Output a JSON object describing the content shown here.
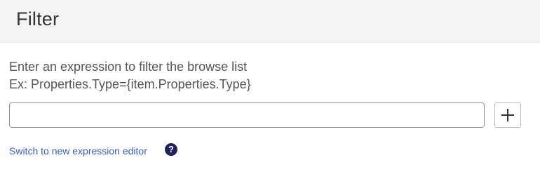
{
  "header": {
    "title": "Filter"
  },
  "description": {
    "line1": "Enter an expression to filter the browse list",
    "line2": "Ex: Properties.Type={item.Properties.Type}"
  },
  "filter_input": {
    "value": "",
    "placeholder": ""
  },
  "add_button": {
    "icon": "plus-icon"
  },
  "switch_link": {
    "label": "Switch to new expression editor"
  },
  "help": {
    "icon": "question-circle-icon",
    "glyph": "?"
  },
  "colors": {
    "header_bg": "#f4f4f4",
    "link": "#3a5cc2",
    "help_icon_bg": "#20205a"
  }
}
